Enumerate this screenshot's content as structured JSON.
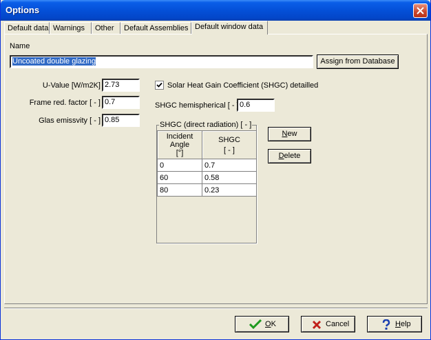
{
  "window": {
    "title": "Options"
  },
  "tabs": [
    {
      "label": "Default data"
    },
    {
      "label": "Warnings"
    },
    {
      "label": "Other"
    },
    {
      "label": "Default Assemblies"
    },
    {
      "label": "Default window data"
    }
  ],
  "active_tab": "Default window data",
  "name_section": {
    "label": "Name",
    "value": "Uncoated double glazing",
    "assign_button": "Assign from Database"
  },
  "fields": {
    "u_value": {
      "label": "U-Value [W/m2K]",
      "value": "2.73"
    },
    "frame_factor": {
      "label": "Frame red. factor [ - ]",
      "value": "0.7"
    },
    "emissivity": {
      "label": "Glas emissvity [ - ]",
      "value": "0.85"
    },
    "shgc_detailed": {
      "label": "Solar Heat Gain Coefficient (SHGC) detailled",
      "checked": true
    },
    "shgc_hemispherical": {
      "label": "SHGC hemispherical [ - ]",
      "value": "0.6"
    }
  },
  "shgc_table": {
    "group_label": "SHGC (direct radiation) [ - ]",
    "headers": {
      "angle_line1": "Incident",
      "angle_line2": "Angle",
      "angle_line3": "[°]",
      "shgc_line1": "SHGC",
      "shgc_line2": "[ - ]"
    },
    "rows": [
      {
        "angle": "0",
        "shgc": "0.7"
      },
      {
        "angle": "60",
        "shgc": "0.58"
      },
      {
        "angle": "80",
        "shgc": "0.23"
      }
    ],
    "new_button": {
      "ul": "N",
      "rest": "ew"
    },
    "delete_button": {
      "ul": "D",
      "rest": "elete"
    }
  },
  "footer": {
    "ok_button": {
      "ul": "O",
      "rest": "K"
    },
    "cancel_button": "Cancel",
    "help_button": {
      "ul": "H",
      "rest": "elp"
    }
  },
  "colors": {
    "titlebar": "#0450D8",
    "selection": "#316AC5",
    "ok_check": "#1E9A1E",
    "cancel_x": "#C0201A",
    "help_q": "#1A3FB0"
  }
}
